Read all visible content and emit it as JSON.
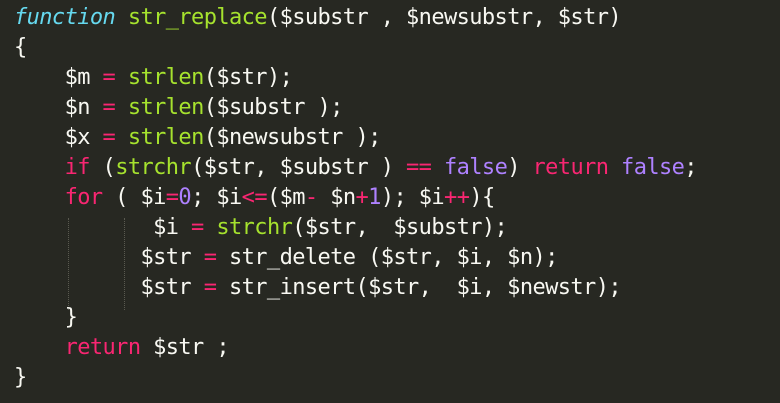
{
  "lines": [
    {
      "tokens": [
        {
          "t": "function",
          "c": "keyword-italic"
        },
        {
          "t": " ",
          "c": "plain"
        },
        {
          "t": "str_replace",
          "c": "func"
        },
        {
          "t": "($substr , $newsubstr, $str)",
          "c": "plain"
        }
      ]
    },
    {
      "tokens": [
        {
          "t": "{",
          "c": "plain"
        }
      ]
    },
    {
      "tokens": [
        {
          "t": "    $m ",
          "c": "plain"
        },
        {
          "t": "=",
          "c": "op"
        },
        {
          "t": " ",
          "c": "plain"
        },
        {
          "t": "strlen",
          "c": "func"
        },
        {
          "t": "($str);",
          "c": "plain"
        }
      ]
    },
    {
      "tokens": [
        {
          "t": "    $n ",
          "c": "plain"
        },
        {
          "t": "=",
          "c": "op"
        },
        {
          "t": " ",
          "c": "plain"
        },
        {
          "t": "strlen",
          "c": "func"
        },
        {
          "t": "($substr );",
          "c": "plain"
        }
      ]
    },
    {
      "tokens": [
        {
          "t": "    $x ",
          "c": "plain"
        },
        {
          "t": "=",
          "c": "op"
        },
        {
          "t": " ",
          "c": "plain"
        },
        {
          "t": "strlen",
          "c": "func"
        },
        {
          "t": "($newsubstr );",
          "c": "plain"
        }
      ]
    },
    {
      "tokens": [
        {
          "t": "    ",
          "c": "plain"
        },
        {
          "t": "if",
          "c": "kw"
        },
        {
          "t": " (",
          "c": "plain"
        },
        {
          "t": "strchr",
          "c": "func"
        },
        {
          "t": "($str, $substr ) ",
          "c": "plain"
        },
        {
          "t": "==",
          "c": "op"
        },
        {
          "t": " ",
          "c": "plain"
        },
        {
          "t": "false",
          "c": "const"
        },
        {
          "t": ") ",
          "c": "plain"
        },
        {
          "t": "return",
          "c": "kw"
        },
        {
          "t": " ",
          "c": "plain"
        },
        {
          "t": "false",
          "c": "const"
        },
        {
          "t": ";",
          "c": "plain"
        }
      ]
    },
    {
      "tokens": [
        {
          "t": "    ",
          "c": "plain"
        },
        {
          "t": "for",
          "c": "kw"
        },
        {
          "t": " ( $i",
          "c": "plain"
        },
        {
          "t": "=",
          "c": "op"
        },
        {
          "t": "0",
          "c": "num"
        },
        {
          "t": "; $i",
          "c": "plain"
        },
        {
          "t": "<=",
          "c": "op"
        },
        {
          "t": "($m",
          "c": "plain"
        },
        {
          "t": "-",
          "c": "op"
        },
        {
          "t": " $n",
          "c": "plain"
        },
        {
          "t": "+",
          "c": "op"
        },
        {
          "t": "1",
          "c": "num"
        },
        {
          "t": "); $i",
          "c": "plain"
        },
        {
          "t": "++",
          "c": "op"
        },
        {
          "t": "){",
          "c": "plain"
        }
      ]
    },
    {
      "tokens": [
        {
          "t": "           $i ",
          "c": "plain"
        },
        {
          "t": "=",
          "c": "op"
        },
        {
          "t": " ",
          "c": "plain"
        },
        {
          "t": "strchr",
          "c": "func"
        },
        {
          "t": "($str,  $substr);",
          "c": "plain"
        }
      ]
    },
    {
      "tokens": [
        {
          "t": "          $str ",
          "c": "plain"
        },
        {
          "t": "=",
          "c": "op"
        },
        {
          "t": " str_delete ($str, $i, $n);",
          "c": "plain"
        }
      ]
    },
    {
      "tokens": [
        {
          "t": "          $str ",
          "c": "plain"
        },
        {
          "t": "=",
          "c": "op"
        },
        {
          "t": " str_insert($str,  $i, $newstr);",
          "c": "plain"
        }
      ]
    },
    {
      "tokens": [
        {
          "t": "    }",
          "c": "plain"
        }
      ]
    },
    {
      "tokens": [
        {
          "t": "    ",
          "c": "plain"
        },
        {
          "t": "return",
          "c": "kw"
        },
        {
          "t": " $str ;",
          "c": "plain"
        }
      ]
    },
    {
      "tokens": [
        {
          "t": "}",
          "c": "plain"
        }
      ]
    }
  ],
  "colors": {
    "background": "#272822",
    "plain": "#f8f8f2",
    "keyword": "#f92672",
    "function_name": "#a6e22e",
    "storage_keyword": "#66d9ef",
    "constant": "#ae81ff",
    "indent_guide": "#5a5a50"
  }
}
